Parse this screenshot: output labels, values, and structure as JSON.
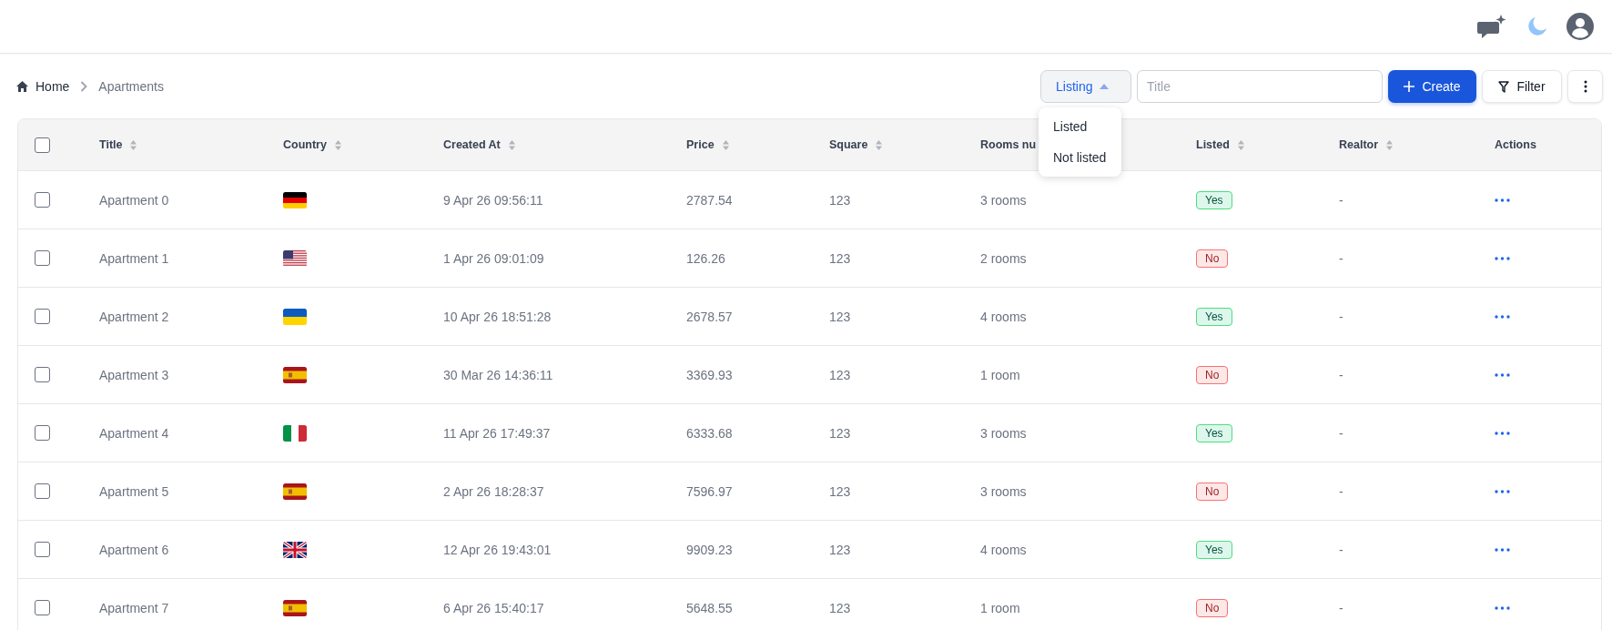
{
  "breadcrumb": [
    {
      "label": "Home",
      "kind": "home"
    },
    {
      "label": "Apartments",
      "kind": "current"
    }
  ],
  "listing_filter": {
    "label": "Listing",
    "expanded": true,
    "options": [
      "Listed",
      "Not listed"
    ]
  },
  "search": {
    "placeholder": "Title"
  },
  "buttons": [
    {
      "label": "Create",
      "kind": "create"
    },
    {
      "label": "Filter",
      "kind": "filter"
    }
  ],
  "table": {
    "select_all_checked": false,
    "columns": [
      {
        "label": "Title",
        "sortable": true
      },
      {
        "label": "Country",
        "sortable": true
      },
      {
        "label": "Created At",
        "sortable": true
      },
      {
        "label": "Price",
        "sortable": true
      },
      {
        "label": "Square",
        "sortable": true
      },
      {
        "label": "Rooms nu",
        "sortable": false
      },
      {
        "label": "Listed",
        "sortable": true
      },
      {
        "label": "Realtor",
        "sortable": true
      },
      {
        "label": "Actions",
        "sortable": false
      }
    ],
    "rows": [
      {
        "checked": false,
        "title": "Apartment 0",
        "country": {
          "kind": "de"
        },
        "created_at": "9 Apr 26 09:56:11",
        "price": "2787.54",
        "square": "123",
        "rooms": "3 rooms",
        "listed": true,
        "listed_label": "Yes",
        "realtor": "-"
      },
      {
        "checked": false,
        "title": "Apartment 1",
        "country": {
          "kind": "us"
        },
        "created_at": "1 Apr 26 09:01:09",
        "price": "126.26",
        "square": "123",
        "rooms": "2 rooms",
        "listed": false,
        "listed_label": "No",
        "realtor": "-"
      },
      {
        "checked": false,
        "title": "Apartment 2",
        "country": {
          "kind": "ua"
        },
        "created_at": "10 Apr 26 18:51:28",
        "price": "2678.57",
        "square": "123",
        "rooms": "4 rooms",
        "listed": true,
        "listed_label": "Yes",
        "realtor": "-"
      },
      {
        "checked": false,
        "title": "Apartment 3",
        "country": {
          "kind": "es"
        },
        "created_at": "30 Mar 26 14:36:11",
        "price": "3369.93",
        "square": "123",
        "rooms": "1 room",
        "listed": false,
        "listed_label": "No",
        "realtor": "-"
      },
      {
        "checked": false,
        "title": "Apartment 4",
        "country": {
          "kind": "it"
        },
        "created_at": "11 Apr 26 17:49:37",
        "price": "6333.68",
        "square": "123",
        "rooms": "3 rooms",
        "listed": true,
        "listed_label": "Yes",
        "realtor": "-"
      },
      {
        "checked": false,
        "title": "Apartment 5",
        "country": {
          "kind": "es"
        },
        "created_at": "2 Apr 26 18:28:37",
        "price": "7596.97",
        "square": "123",
        "rooms": "3 rooms",
        "listed": false,
        "listed_label": "No",
        "realtor": "-"
      },
      {
        "checked": false,
        "title": "Apartment 6",
        "country": {
          "kind": "gb"
        },
        "created_at": "12 Apr 26 19:43:01",
        "price": "9909.23",
        "square": "123",
        "rooms": "4 rooms",
        "listed": true,
        "listed_label": "Yes",
        "realtor": "-"
      },
      {
        "checked": false,
        "title": "Apartment 7",
        "country": {
          "kind": "es"
        },
        "created_at": "6 Apr 26 15:40:17",
        "price": "5648.55",
        "square": "123",
        "rooms": "1 room",
        "listed": false,
        "listed_label": "No",
        "realtor": "-"
      }
    ]
  }
}
